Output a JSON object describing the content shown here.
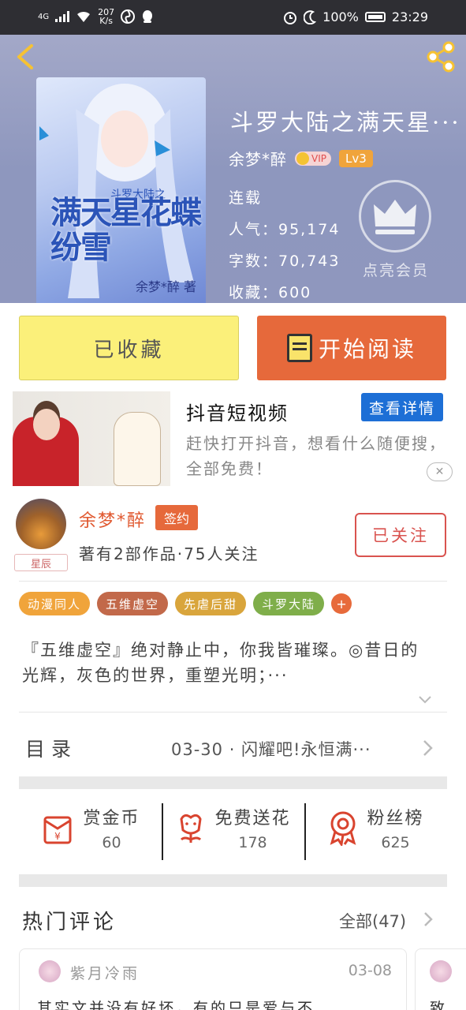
{
  "status_bar": {
    "signal": "4G",
    "net_speed_value": "207",
    "net_speed_unit": "K/s",
    "battery": "100%",
    "time": "23:29"
  },
  "book": {
    "title": "斗罗大陆之满天星···",
    "author": "余梦*醉",
    "vip_label": "VIP",
    "level": "Lv3",
    "status": "连载",
    "popularity": "人气：95,174",
    "word_count": "字数：70,743",
    "favorites": "收藏：600",
    "vip_member": "点亮会员",
    "cover": {
      "series": "斗罗大陆之",
      "title": "满天星花蝶纷雪",
      "author": "余梦*醉 著"
    }
  },
  "actions": {
    "collected": "已收藏",
    "start_read": "开始阅读"
  },
  "ad": {
    "title": "抖音短视频",
    "detail_button": "查看详情",
    "description": "赶快打开抖音，想看什么随便搜，全部免费！",
    "close": "✕"
  },
  "author": {
    "name": "余梦*醉",
    "contract": "签约",
    "badge": "星辰",
    "info": "著有2部作品·75人关注",
    "follow": "已关注"
  },
  "tags": [
    {
      "label": "动漫同人",
      "color": "#f0a43b"
    },
    {
      "label": "五维虚空",
      "color": "#c2694a"
    },
    {
      "label": "先虐后甜",
      "color": "#d9a53c"
    },
    {
      "label": "斗罗大陆",
      "color": "#7fae4a"
    }
  ],
  "tag_more": "+",
  "intro": "『五维虚空』绝对静止中，你我皆璀璨。◎昔日的光辉，灰色的世界，重塑光明；···",
  "toc": {
    "label": "目录",
    "latest": "03-30 · 闪耀吧!永恒满···"
  },
  "stats": [
    {
      "label": "赏金币",
      "value": "60"
    },
    {
      "label": "免费送花",
      "value": "178"
    },
    {
      "label": "粉丝榜",
      "value": "625"
    }
  ],
  "comments": {
    "title": "热门评论",
    "all": "全部(47)",
    "items": [
      {
        "name": "紫月冷雨",
        "date": "03-08",
        "text": "其实文并没有好坏，有的只是爱与不"
      },
      {
        "text": "致"
      }
    ]
  }
}
